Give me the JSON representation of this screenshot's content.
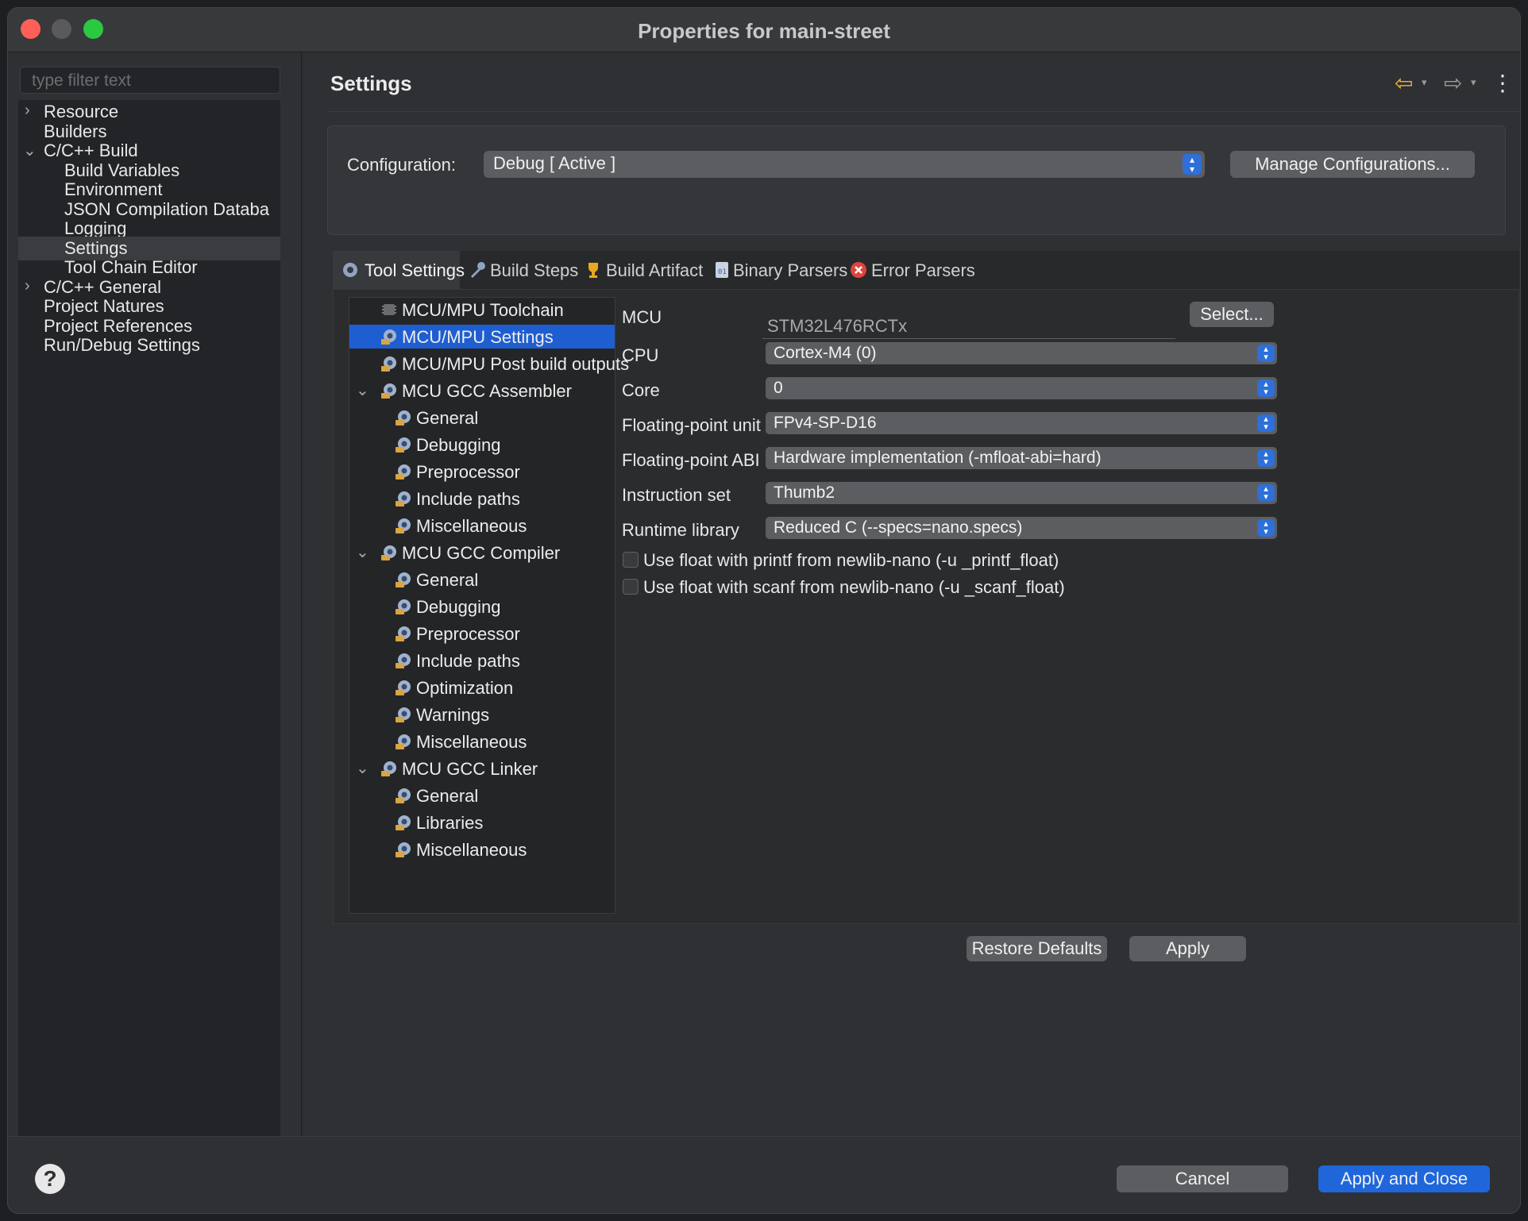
{
  "window": {
    "title": "Properties for main-street"
  },
  "left": {
    "filter_placeholder": "type filter text",
    "items": [
      {
        "label": "Resource",
        "chev": "›"
      },
      {
        "label": "Builders",
        "chev": ""
      },
      {
        "label": "C/C++ Build",
        "chev": "⌄"
      },
      {
        "label": "Build Variables",
        "chev": ""
      },
      {
        "label": "Environment",
        "chev": ""
      },
      {
        "label": "JSON Compilation Databa",
        "chev": ""
      },
      {
        "label": "Logging",
        "chev": ""
      },
      {
        "label": "Settings",
        "chev": ""
      },
      {
        "label": "Tool Chain Editor",
        "chev": ""
      },
      {
        "label": "C/C++ General",
        "chev": "›"
      },
      {
        "label": "Project Natures",
        "chev": ""
      },
      {
        "label": "Project References",
        "chev": ""
      },
      {
        "label": "Run/Debug Settings",
        "chev": ""
      }
    ]
  },
  "main": {
    "title": "Settings",
    "config_label": "Configuration:",
    "config_value": "Debug  [ Active ]",
    "manage_button": "Manage Configurations...",
    "tabs": [
      "Tool Settings",
      "Build Steps",
      "Build Artifact",
      "Binary Parsers",
      "Error Parsers"
    ],
    "tool_tree": [
      {
        "label": "MCU/MPU Toolchain",
        "chev": ""
      },
      {
        "label": "MCU/MPU Settings",
        "chev": ""
      },
      {
        "label": "MCU/MPU Post build outputs",
        "chev": ""
      },
      {
        "label": "MCU GCC Assembler",
        "chev": "⌄"
      },
      {
        "label": "General",
        "chev": ""
      },
      {
        "label": "Debugging",
        "chev": ""
      },
      {
        "label": "Preprocessor",
        "chev": ""
      },
      {
        "label": "Include paths",
        "chev": ""
      },
      {
        "label": "Miscellaneous",
        "chev": ""
      },
      {
        "label": "MCU GCC Compiler",
        "chev": "⌄"
      },
      {
        "label": "General",
        "chev": ""
      },
      {
        "label": "Debugging",
        "chev": ""
      },
      {
        "label": "Preprocessor",
        "chev": ""
      },
      {
        "label": "Include paths",
        "chev": ""
      },
      {
        "label": "Optimization",
        "chev": ""
      },
      {
        "label": "Warnings",
        "chev": ""
      },
      {
        "label": "Miscellaneous",
        "chev": ""
      },
      {
        "label": "MCU GCC Linker",
        "chev": "⌄"
      },
      {
        "label": "General",
        "chev": ""
      },
      {
        "label": "Libraries",
        "chev": ""
      },
      {
        "label": "Miscellaneous",
        "chev": ""
      }
    ],
    "form": {
      "mcu_label": "MCU",
      "mcu_value": "STM32L476RCTx",
      "select_button": "Select...",
      "cpu_label": "CPU",
      "cpu_value": "Cortex-M4 (0)",
      "core_label": "Core",
      "core_value": "0",
      "fpu_label": "Floating-point unit",
      "fpu_value": "FPv4-SP-D16",
      "abi_label": "Floating-point ABI",
      "abi_value": "Hardware implementation (-mfloat-abi=hard)",
      "iset_label": "Instruction set",
      "iset_value": "Thumb2",
      "rt_label": "Runtime library",
      "rt_value": "Reduced C (--specs=nano.specs)",
      "printf_label": "Use float with printf from newlib-nano (-u _printf_float)",
      "scanf_label": "Use float with scanf from newlib-nano (-u _scanf_float)"
    },
    "restore_button": "Restore Defaults",
    "apply_button": "Apply"
  },
  "bottom": {
    "help": "?",
    "cancel_button": "Cancel",
    "ok_button": "Apply and Close"
  },
  "colors": {
    "accent": "#1f66db",
    "selection": "#1f5ed1"
  }
}
